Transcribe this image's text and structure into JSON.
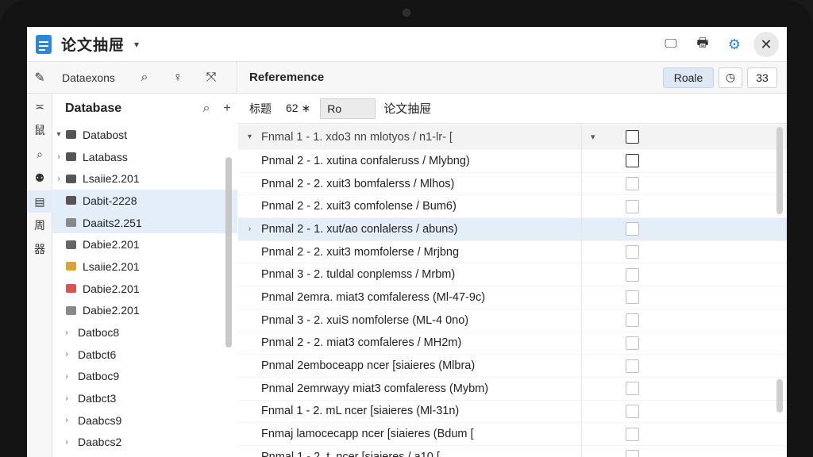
{
  "app": {
    "title": "论文抽屉",
    "caret": "▾",
    "actions": {
      "monitor": "🖵",
      "print": "🖶",
      "gear": "⚙",
      "close": "✕"
    }
  },
  "left_toolbar": {
    "label": "Dataexons"
  },
  "rail": [
    "≍",
    "鼠",
    "⌕",
    "⚉",
    "▤",
    "周",
    "器"
  ],
  "tree": {
    "title": "Database",
    "items": [
      {
        "label": "Databost",
        "chev": "▾",
        "color": "#555555",
        "sel": false
      },
      {
        "label": "Latabass",
        "chev": "›",
        "color": "#555555",
        "sel": false
      },
      {
        "label": "Lsaiie2.201",
        "chev": "›",
        "color": "#555555",
        "sel": false
      },
      {
        "label": "Dabit-2228",
        "chev": "",
        "color": "#555555",
        "sel": true
      },
      {
        "label": "Daaits2.251",
        "chev": "",
        "color": "#888888",
        "sel": true
      },
      {
        "label": "Dabie2.201",
        "chev": "",
        "color": "#666666",
        "sel": false
      },
      {
        "label": "Lsaiie2.201",
        "chev": "",
        "color": "#d9a23a",
        "sel": false
      },
      {
        "label": "Dabie2.201",
        "chev": "",
        "color": "#d9534f",
        "sel": false
      },
      {
        "label": "Dabie2.201",
        "chev": "",
        "color": "#888888",
        "sel": false
      },
      {
        "label": "Datboc8",
        "chev": "›",
        "color": "",
        "sel": false
      },
      {
        "label": "Datbct6",
        "chev": "›",
        "color": "",
        "sel": false
      },
      {
        "label": "Datboc9",
        "chev": "›",
        "color": "",
        "sel": false
      },
      {
        "label": "Datbct3",
        "chev": "›",
        "color": "",
        "sel": false
      },
      {
        "label": "Daabcs9",
        "chev": "›",
        "color": "",
        "sel": false
      },
      {
        "label": "Daabcs2",
        "chev": "›",
        "color": "",
        "sel": false
      }
    ]
  },
  "main": {
    "title": "Referemence",
    "btn_primary": "Roale",
    "btn_count": "33",
    "filter": {
      "label": "标题",
      "size": "62 ∗",
      "input_value": "Ro",
      "title": "论文抽屉"
    },
    "header_row": {
      "chev": "▾",
      "text": "Fnmal 1  -  1.      xdo3   nn  mlotyos / n1-lr-  [",
      "ex": "▾"
    },
    "rows": [
      {
        "text": "Pnmal 2  -  1.      xutina   confaleruss / Mlybng)",
        "hl": false,
        "dark": true
      },
      {
        "text": "Pnmal 2  -  2.      xuit3    bomfalerss / Mlhos)",
        "hl": false,
        "dark": false
      },
      {
        "text": "Pnmal 2  -  2.      xuit3    comfolense / Bum6)",
        "hl": false,
        "dark": false
      },
      {
        "text": "Pnmal 2  -  1.      xut/ao   conlalerss / abuns)",
        "hl": true,
        "dark": false,
        "chev": "›"
      },
      {
        "text": "Pnmal 2  -  2.      xuit3    momfolerse / Mrjbng",
        "hl": false,
        "dark": false
      },
      {
        "text": "Pnmal 3  -  2.      tuldal   conplemss / Mrbm)",
        "hl": false,
        "dark": false
      },
      {
        "text": "Pnmal 2emra.      miat3    comfaleress (Ml-47-9c)",
        "hl": false,
        "dark": false
      },
      {
        "text": "Pnmal 3  -  2.      xuiS     nomfolerse (ML-4 0no)",
        "hl": false,
        "dark": false
      },
      {
        "text": "Pnmal 2  -  2.      miat3    comfaleres / MH2m)",
        "hl": false,
        "dark": false
      },
      {
        "text": "Pnmal 2emboceapp   ncer [siaieres (Mlbra)",
        "hl": false,
        "dark": false
      },
      {
        "text": "Pnmal 2emrwayy miat3    comfaleress (Mybm)",
        "hl": false,
        "dark": false
      },
      {
        "text": "Fnmal 1  -  2.      mL   ncer [siaieres (Ml-31n)",
        "hl": false,
        "dark": false
      },
      {
        "text": "Fnmaj lamocecapp   ncer [siaieres (Bdum  [",
        "hl": false,
        "dark": false
      },
      {
        "text": "Pnmal 1  -  2.      t.    ncer [siaieres / a10  [",
        "hl": false,
        "dark": false
      }
    ]
  }
}
